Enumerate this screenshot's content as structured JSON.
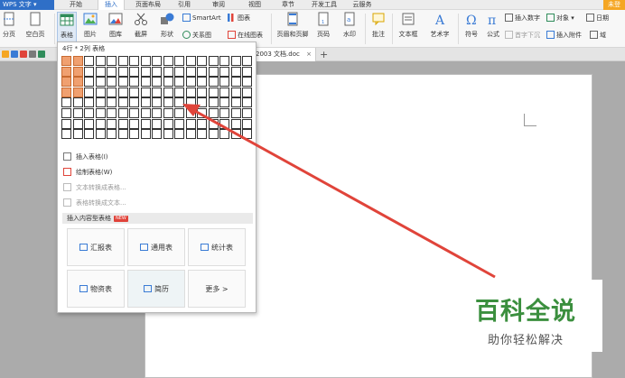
{
  "app": {
    "title": "WPS 文字"
  },
  "menu": {
    "tabs": [
      "开始",
      "插入",
      "页面布局",
      "引用",
      "审阅",
      "视图",
      "章节",
      "开发工具",
      "云服务"
    ],
    "active": "插入",
    "user_label": "未登"
  },
  "ribbon": {
    "left_partial": [
      "分页",
      "空白页"
    ],
    "table": "表格",
    "picture": "图片",
    "gallery": "图库",
    "screenshot": "截屏",
    "shapes": "形状",
    "smartart": "SmartArt",
    "chart": "图表",
    "relation": "关系图",
    "online_chart": "在线图表",
    "header_footer": "页眉和页脚",
    "page_number": "页码",
    "watermark": "水印",
    "comment": "批注",
    "textbox": "文本框",
    "wordart": "艺术字",
    "symbol": "符号",
    "formula": "公式",
    "insert_number": "插入数字",
    "first_letter": "首字下沉",
    "object": "对象",
    "attachment": "插入附件",
    "date": "日期",
    "field": "域"
  },
  "document_tab": {
    "name": "2003 文档.doc",
    "close": "×",
    "new_tab": "+"
  },
  "table_panel": {
    "grid_hint": "4行 * 2列 表格",
    "grid_rows": 8,
    "grid_cols": 17,
    "selected_rows": 4,
    "selected_cols": 2,
    "items": [
      {
        "label": "插入表格(I)",
        "enabled": true
      },
      {
        "label": "绘制表格(W)",
        "enabled": true
      },
      {
        "label": "文本转换成表格...",
        "enabled": false
      },
      {
        "label": "表格转换成文本...",
        "enabled": false
      }
    ],
    "content_header": "插入内容型表格",
    "new_badge": "NEW",
    "cards": [
      "汇报表",
      "通用表",
      "统计表",
      "物资表",
      "简历",
      "更多 >"
    ]
  },
  "annotation": {
    "arrow_color": "#e0443a"
  },
  "watermark": {
    "title": "百科全说",
    "subtitle": "助你轻松解决"
  }
}
